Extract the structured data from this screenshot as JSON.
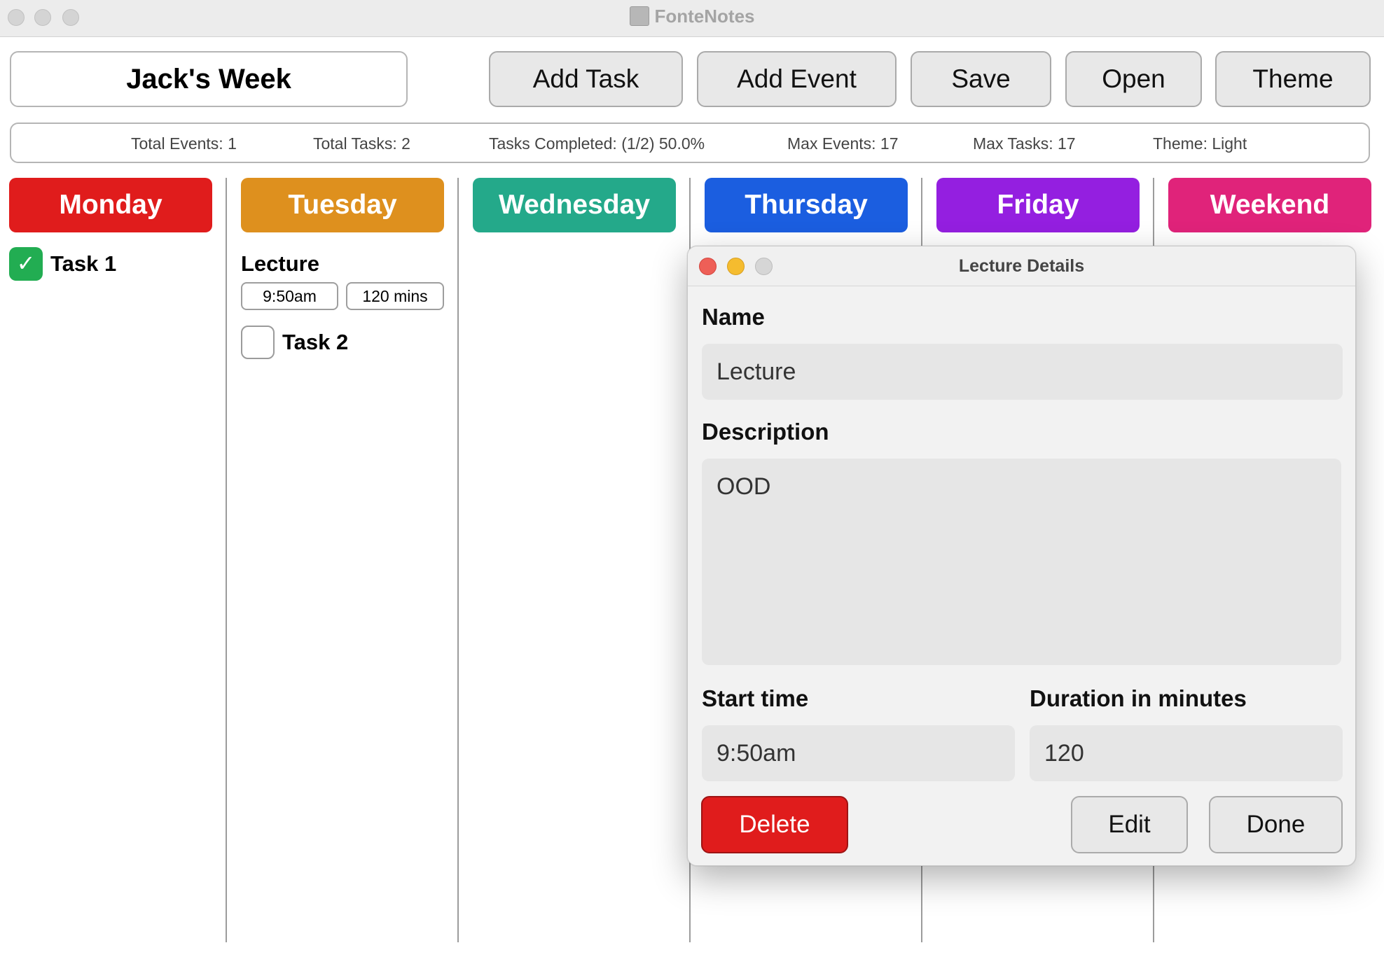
{
  "window": {
    "title": "FonteNotes"
  },
  "toolbar": {
    "week_name": "Jack's Week",
    "add_task": "Add Task",
    "add_event": "Add Event",
    "save": "Save",
    "open": "Open",
    "theme": "Theme"
  },
  "stats": {
    "total_events": "Total Events: 1",
    "total_tasks": "Total Tasks: 2",
    "tasks_completed": "Tasks Completed: (1/2) 50.0%",
    "max_events": "Max Events: 17",
    "max_tasks": "Max Tasks: 17",
    "theme": "Theme: Light"
  },
  "days": [
    {
      "label": "Monday",
      "color": "#e01c1c"
    },
    {
      "label": "Tuesday",
      "color": "#de901e"
    },
    {
      "label": "Wednesday",
      "color": "#24a98a"
    },
    {
      "label": "Thursday",
      "color": "#1b5ee0"
    },
    {
      "label": "Friday",
      "color": "#941fe0"
    },
    {
      "label": "Weekend",
      "color": "#e0237a"
    }
  ],
  "monday": {
    "tasks": [
      {
        "label": "Task 1",
        "completed": true,
        "check_glyph": "✓"
      }
    ]
  },
  "tuesday": {
    "events": [
      {
        "name": "Lecture",
        "start": "9:50am",
        "duration": "120 mins"
      }
    ],
    "tasks": [
      {
        "label": "Task 2",
        "completed": false
      }
    ]
  },
  "dialog": {
    "title": "Lecture Details",
    "name_label": "Name",
    "name_value": "Lecture",
    "description_label": "Description",
    "description_value": "OOD",
    "start_label": "Start time",
    "start_value": "9:50am",
    "duration_label": "Duration in minutes",
    "duration_value": "120",
    "delete_label": "Delete",
    "edit_label": "Edit",
    "done_label": "Done"
  },
  "colors": {
    "close": "#ee5f57",
    "minimize": "#f5bc2f",
    "zoom_inactive": "#d6d6d6",
    "delete": "#e01c1c",
    "task_done": "#22ad52"
  }
}
